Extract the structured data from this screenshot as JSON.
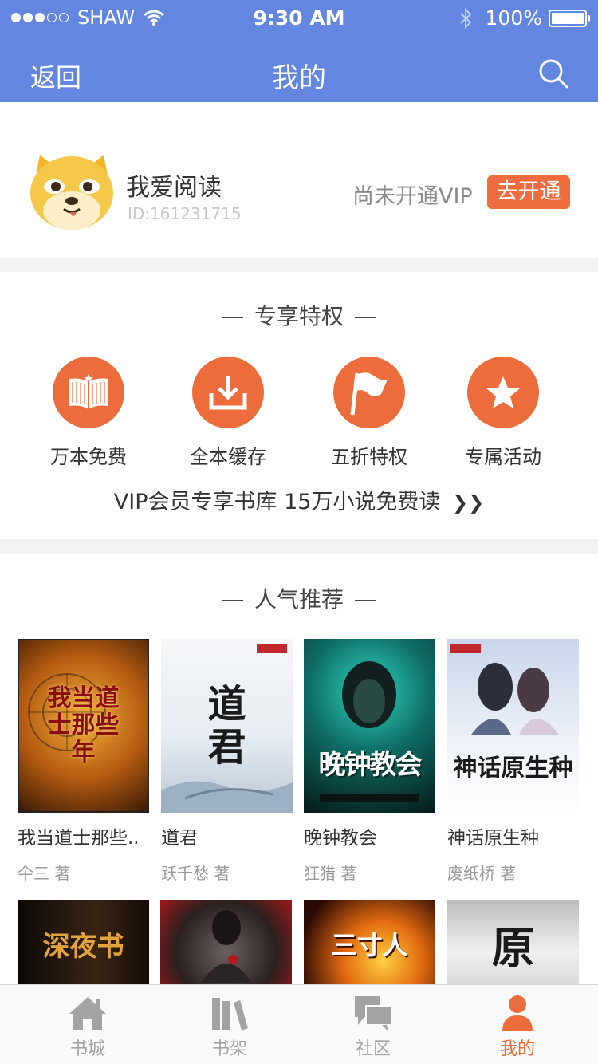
{
  "status_bar": {
    "carrier": "SHAW",
    "time": "9:30 AM",
    "battery": "100%",
    "signal_bars": 3
  },
  "nav": {
    "back": "返回",
    "title": "我的",
    "search_icon": "search-icon"
  },
  "profile": {
    "name": "我爱阅读",
    "id": "ID:161231715",
    "vip_status": "尚未开通VIP",
    "vip_button": "去开通"
  },
  "privileges": {
    "title": "专享特权",
    "items": [
      {
        "label": "万本免费",
        "icon": "open-book-icon"
      },
      {
        "label": "全本缓存",
        "icon": "download-icon"
      },
      {
        "label": "五折特权",
        "icon": "flag-icon"
      },
      {
        "label": "专属活动",
        "icon": "star-icon"
      }
    ],
    "library_link": "VIP会员专享书库 15万小说免费读"
  },
  "recommend": {
    "title": "人气推荐",
    "books": [
      {
        "title": "我当道士那些..",
        "author": "仐三  著",
        "cover_text": "我当道士那些年",
        "cover_color": "#8a4a12"
      },
      {
        "title": "道君",
        "author": "跃千愁  著",
        "cover_text": "道君",
        "cover_color": "#e8eef4"
      },
      {
        "title": "晚钟教会",
        "author": "狂猎  著",
        "cover_text": "晚钟教会",
        "cover_color": "#0d3a35"
      },
      {
        "title": "神话原生种",
        "author": "废纸桥  著",
        "cover_text": "神话原生种",
        "cover_color": "#dfe7f3"
      }
    ],
    "more_covers": [
      {
        "cover_text": "深夜书",
        "cover_color": "#2a1a0e"
      },
      {
        "cover_text": "",
        "cover_color": "#3a3030"
      },
      {
        "cover_text": "三寸人",
        "cover_color": "#8a2a0a"
      },
      {
        "cover_text": "原",
        "cover_color": "#e4e4e4"
      }
    ]
  },
  "tabbar": {
    "items": [
      {
        "label": "书城",
        "icon": "home-icon"
      },
      {
        "label": "书架",
        "icon": "bookshelf-icon"
      },
      {
        "label": "社区",
        "icon": "chat-icon"
      },
      {
        "label": "我的",
        "icon": "user-icon"
      }
    ],
    "active_index": 3
  },
  "colors": {
    "header": "#6387e0",
    "accent": "#ec6c3b",
    "tab_inactive": "#a3a3a3"
  }
}
